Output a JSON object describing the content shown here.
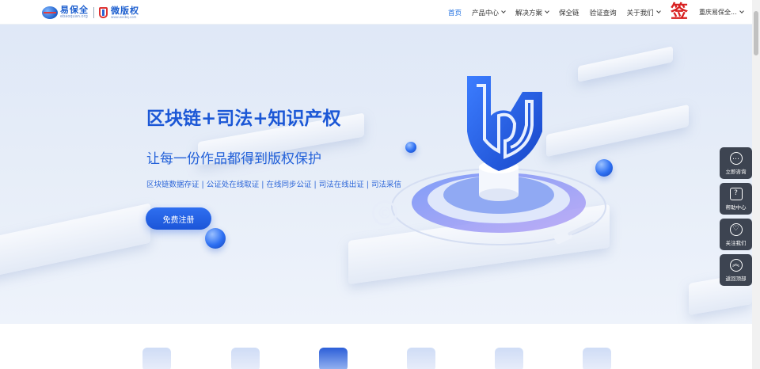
{
  "header": {
    "logo_primary": "易保全",
    "logo_primary_sub": "ebaoquan.org",
    "logo_secondary": "微版权",
    "logo_secondary_sub": "www.weibq.com",
    "nav": [
      {
        "label": "首页",
        "active": true,
        "has_dropdown": false
      },
      {
        "label": "产品中心",
        "active": false,
        "has_dropdown": true
      },
      {
        "label": "解决方案",
        "active": false,
        "has_dropdown": true
      },
      {
        "label": "保全链",
        "active": false,
        "has_dropdown": false
      },
      {
        "label": "验证查询",
        "active": false,
        "has_dropdown": false
      },
      {
        "label": "关于我们",
        "active": false,
        "has_dropdown": true
      }
    ],
    "sign_glyph": "签",
    "company": "重庆易保全..."
  },
  "hero": {
    "title": "区块链+司法+知识产权",
    "subtitle": "让每一份作品都得到版权保护",
    "tags": "区块链数据存证 | 公证处在线取证 | 在线同步公证 | 司法在线出证 | 司法采信",
    "cta": "免费注册",
    "accent_color": "#1b57d6"
  },
  "side_panel": [
    {
      "label": "立即咨询",
      "icon": "chat-icon"
    },
    {
      "label": "帮助中心",
      "icon": "help-icon"
    },
    {
      "label": "关注我们",
      "icon": "heart-icon"
    },
    {
      "label": "返回顶部",
      "icon": "back-top-icon"
    }
  ]
}
